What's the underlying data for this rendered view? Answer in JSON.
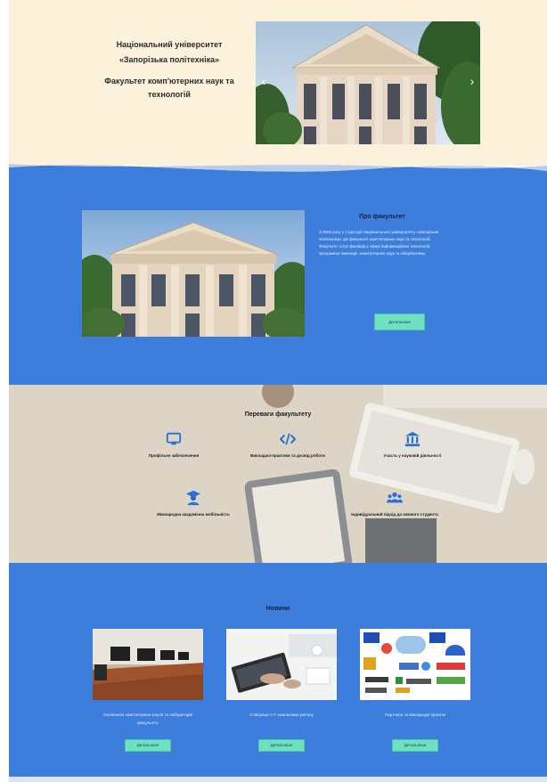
{
  "hero": {
    "university_line1": "Національний університет",
    "university_line2": "«Запорізька політехніка»",
    "faculty_line1": "Факультет комп'ютерних наук та",
    "faculty_line2": "технологій",
    "prev_arrow": "‹",
    "next_arrow": "›"
  },
  "about": {
    "title": "Про факультет",
    "body": "З 2006 року у структурі Національного університету «Запорізька політехніка» діє факультет комп'ютерних наук та технологій. Факультет готує фахівців у сфері інформаційних технологій, програмної інженерії, комп'ютерних наук та кібербезпеки.",
    "button_label": "Детальніше"
  },
  "advantages": {
    "title": "Переваги факультету",
    "items": [
      {
        "label": "Профільне забезпечення",
        "icon": "monitor-icon"
      },
      {
        "label": "Викладачі-практики та досвід роботи",
        "icon": "code-icon"
      },
      {
        "label": "Участь у науковій діяльності",
        "icon": "institution-icon"
      },
      {
        "label": "Міжнародна академічна мобільність",
        "icon": "graduate-icon"
      },
      {
        "label": "Індивідуальний підхід до кожного студента",
        "icon": "users-icon"
      }
    ]
  },
  "news": {
    "title": "Новини",
    "items": [
      {
        "caption": "Оновлення комп'ютерних класів та лабораторій факультету",
        "button_label": "Детальніше"
      },
      {
        "caption": "Співпраця з ІТ-компаніями регіону",
        "button_label": "Детальніше"
      },
      {
        "caption": "Партнери та міжнародні проєкти",
        "button_label": "Детальніше"
      }
    ]
  },
  "colors": {
    "hero_bg": "#fcf2dc",
    "section_blue": "#3d7ddb",
    "advantages_bg": "#dcd5c5",
    "button_bg": "#6ee1c1",
    "icon_blue": "#2a6fd6"
  }
}
